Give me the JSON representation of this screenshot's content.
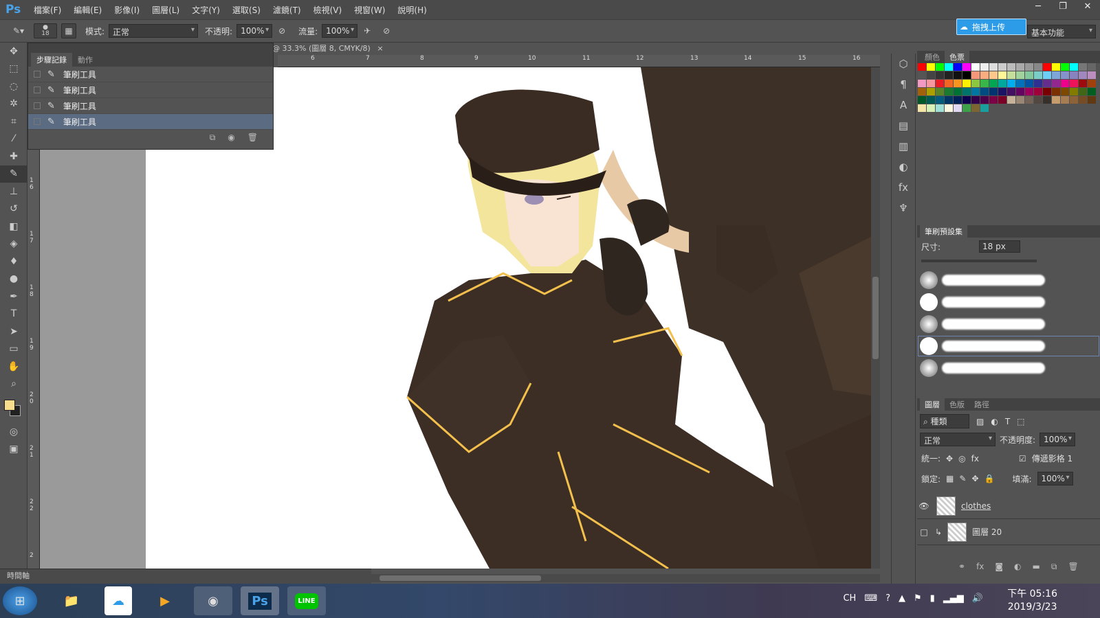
{
  "app": {
    "logo": "Ps"
  },
  "menu": [
    "檔案(F)",
    "編輯(E)",
    "影像(I)",
    "圖層(L)",
    "文字(Y)",
    "選取(S)",
    "濾鏡(T)",
    "檢視(V)",
    "視窗(W)",
    "說明(H)"
  ],
  "window_controls": {
    "minimize": "─",
    "restore": "❐",
    "close": "✕"
  },
  "options": {
    "brush_size": "18",
    "mode_label": "模式:",
    "mode_value": "正常",
    "opacity_label": "不透明:",
    "opacity_value": "100%",
    "flow_label": "流量:",
    "flow_value": "100%",
    "upload_btn": "拖拽上传",
    "workspace": "基本功能"
  },
  "document": {
    "tab": "@ 33.3% (圖層 8, CMYK/8)",
    "tab_close": "×"
  },
  "ruler_top": [
    "6",
    "7",
    "8",
    "9",
    "10",
    "11",
    "12",
    "13",
    "14",
    "15",
    "16"
  ],
  "ruler_left": [
    "1 6",
    "1 7",
    "1 8",
    "1 9",
    "2 0",
    "2 1",
    "2 2",
    "2"
  ],
  "history": {
    "tabs": [
      "步驟記錄",
      "動作"
    ],
    "items": [
      "筆刷工具",
      "筆刷工具",
      "筆刷工具",
      "筆刷工具"
    ]
  },
  "timeline": {
    "label": "時間軸"
  },
  "color_panel": {
    "tabs": [
      "顏色",
      "色票"
    ]
  },
  "swatch_colors": [
    "#ff0000",
    "#ffff00",
    "#00ff00",
    "#00ffff",
    "#0000ff",
    "#ff00ff",
    "#ffffff",
    "#eeeeee",
    "#dddddd",
    "#cccccc",
    "#bbbbbb",
    "#aaaaaa",
    "#999999",
    "#888888",
    "#ff0000",
    "#ffff00",
    "#00ff00",
    "#00ffff",
    "#777777",
    "#666666",
    "#555555",
    "#444444",
    "#333333",
    "#222222",
    "#111111",
    "#000000",
    "#f7977a",
    "#f9ad81",
    "#fdc68a",
    "#fff79a",
    "#c4df9b",
    "#a3d39c",
    "#82ca9d",
    "#7bcdc8",
    "#6ecff6",
    "#7ea7d8",
    "#8493ca",
    "#8882be",
    "#a187be",
    "#bc8dbf",
    "#f49ac2",
    "#f6989d",
    "#ed1c24",
    "#f26522",
    "#f7941d",
    "#fff200",
    "#8dc73f",
    "#39b54a",
    "#00a651",
    "#00a99d",
    "#00aeef",
    "#0072bc",
    "#0054a6",
    "#2e3192",
    "#662d91",
    "#92278f",
    "#ec008c",
    "#ed145b",
    "#9e0b0f",
    "#a0410d",
    "#a36209",
    "#aba000",
    "#598527",
    "#1a7b30",
    "#007236",
    "#00746b",
    "#0076a3",
    "#004b80",
    "#003471",
    "#1b1464",
    "#440e62",
    "#630460",
    "#9e005d",
    "#9e0039",
    "#790000",
    "#7b2e00",
    "#7d4900",
    "#827b00",
    "#406618",
    "#005e20",
    "#005826",
    "#005952",
    "#005b7f",
    "#003663",
    "#002157",
    "#0d004c",
    "#32004b",
    "#4b0049",
    "#7b0046",
    "#7a0026",
    "#c7b299",
    "#998675",
    "#736357",
    "#534741",
    "#37302a",
    "#c69c6d",
    "#a67c52",
    "#8c6239",
    "#754c24",
    "#603913",
    "#f5e6a8",
    "#d7f0b8",
    "#9fe0d6",
    "#fff8e0",
    "#e0d8f0",
    "#3fa04a",
    "#7b6530",
    "#1a9e9e"
  ],
  "brush_presets": {
    "title": "筆刷預設集",
    "size_label": "尺寸:",
    "size_value": "18 px"
  },
  "layers": {
    "tabs": [
      "圖層",
      "色版",
      "路徑"
    ],
    "filter": "種類",
    "blend": "正常",
    "opacity_label": "不透明度:",
    "opacity": "100%",
    "unify_label": "統一:",
    "propagate": "傳遞影格 1",
    "lock_label": "鎖定:",
    "fill_label": "填滿:",
    "fill": "100%",
    "items": [
      "clothes",
      "圖層 20"
    ]
  },
  "taskbar": {
    "lang": "CH",
    "time": "下午 05:16",
    "date": "2019/3/23"
  }
}
